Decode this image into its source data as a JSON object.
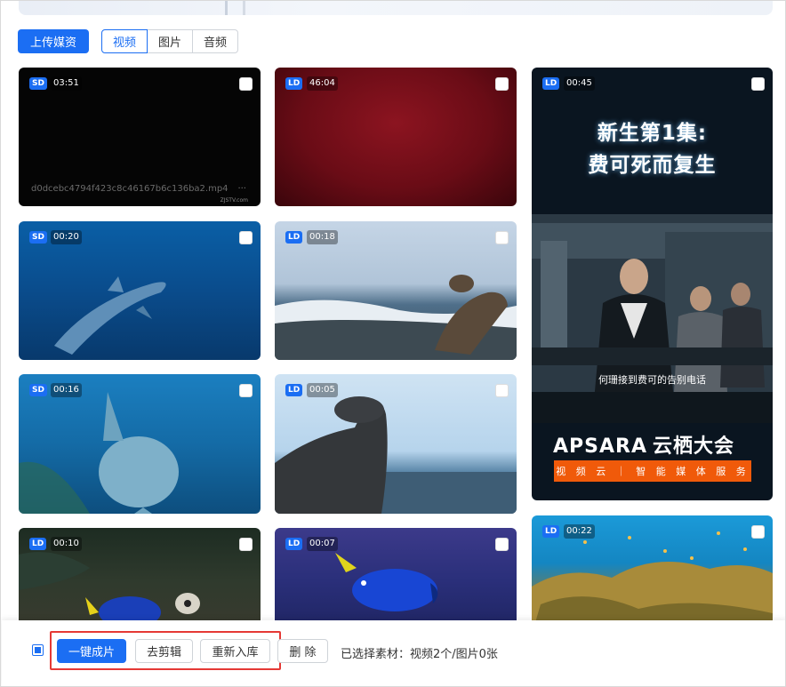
{
  "toolbar": {
    "upload_label": "上传媒资",
    "tabs": [
      {
        "label": "视频",
        "active": true
      },
      {
        "label": "图片",
        "active": false
      },
      {
        "label": "音频",
        "active": false
      }
    ]
  },
  "media": [
    {
      "quality": "SD",
      "duration": "03:51",
      "filename": "d0dcebc4794f423c8c46167b6c136ba2.mp4",
      "more": "···",
      "watermark": "ZJSTV.com"
    },
    {
      "quality": "LD",
      "duration": "46:04"
    },
    {
      "quality": "LD",
      "duration": "00:45",
      "poster": {
        "title_line1": "新生第1集:",
        "title_line2": "费可死而复生",
        "subtitle": "何珊接到费可的告别电话",
        "brand_en": "APSARA",
        "brand_cn": "云栖大会",
        "tagline": "视 频 云 ｜ 智 能 媒 体 服 务"
      }
    },
    {
      "quality": "SD",
      "duration": "00:20"
    },
    {
      "quality": "LD",
      "duration": "00:18"
    },
    {
      "quality": "SD",
      "duration": "00:16"
    },
    {
      "quality": "LD",
      "duration": "00:05"
    },
    {
      "quality": "LD",
      "duration": "00:10"
    },
    {
      "quality": "LD",
      "duration": "00:07"
    },
    {
      "quality": "LD",
      "duration": "00:22"
    }
  ],
  "bottom_bar": {
    "one_click_label": "一键成片",
    "edit_label": "去剪辑",
    "reimport_label": "重新入库",
    "delete_label": "删 除",
    "selection_text": "已选择素材：视频2个/图片0张"
  },
  "colors": {
    "primary": "#1b6ef3",
    "highlight_border": "#e53935",
    "poster_bar": "#f05a0a"
  }
}
